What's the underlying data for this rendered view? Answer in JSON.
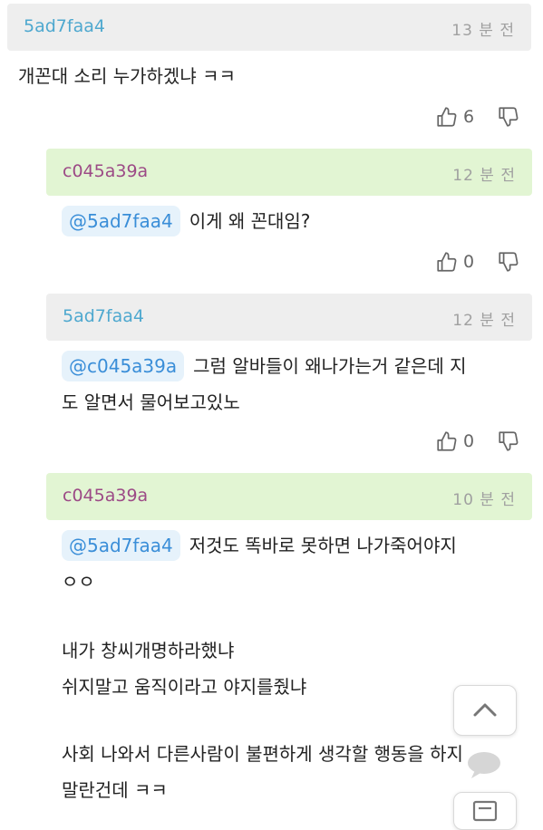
{
  "comments": [
    {
      "user": "5ad7faa4",
      "time": "13 분 전",
      "text": "개꼰대 소리 누가하겠냐 ㅋㅋ",
      "likes": "6"
    },
    {
      "user": "c045a39a",
      "time": "12 분 전",
      "mention": "@5ad7faa4",
      "text": "이게 왜 꼰대임?",
      "likes": "0"
    },
    {
      "user": "5ad7faa4",
      "time": "12 분 전",
      "mention": "@c045a39a",
      "text_line1": "그럼 알바들이 왜나가는거 같은데 지",
      "text_line2": "도 알면서 물어보고있노",
      "likes": "0"
    },
    {
      "user": "c045a39a",
      "time": "10 분 전",
      "mention": "@5ad7faa4",
      "text_line1": "저것도 똑바로 못하면 나가죽어야지",
      "text_line2": "ㅇㅇ",
      "para2_line1": "내가 창씨개명하라했냐",
      "para2_line2": "쉬지말고 움직이라고 야지를줬냐",
      "para3_line1": "사회 나와서 다른사람이 불편하게 생각할 행동을 하지",
      "para3_line2": "말란건데 ㅋㅋ"
    }
  ],
  "colors": {
    "header_gray": "#eeeeee",
    "header_green": "#e2f5d3",
    "user_blue": "#4ea8cf",
    "user_purple": "#9c4a86",
    "mention_bg": "#e6f2fb",
    "mention_text": "#3a8ed8"
  },
  "icons": {
    "like": "thumbs-up-icon",
    "dislike": "thumbs-down-icon",
    "scroll_top": "chevron-up-icon",
    "chat": "chat-bubble-icon",
    "list": "list-icon"
  }
}
